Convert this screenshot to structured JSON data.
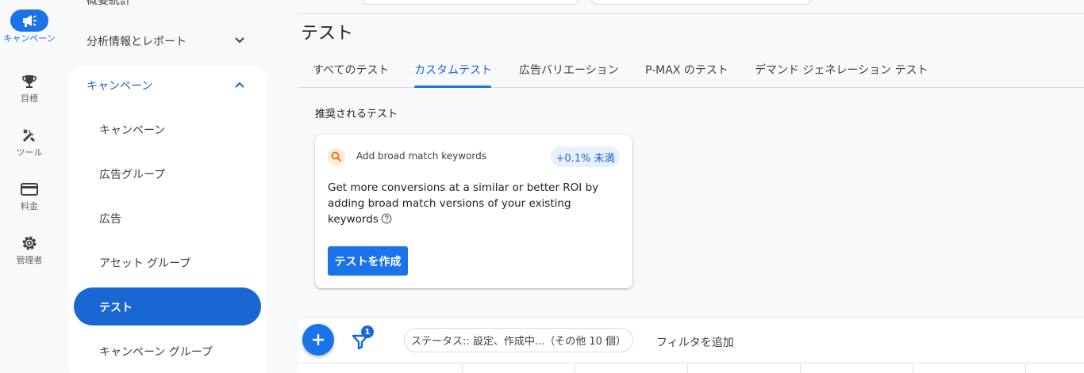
{
  "rail": {
    "items": [
      {
        "label": "キャンペーン",
        "icon": "megaphone-icon",
        "active": true
      },
      {
        "label": "目標",
        "icon": "trophy-icon",
        "active": false
      },
      {
        "label": "ツール",
        "icon": "tools-icon",
        "active": false
      },
      {
        "label": "料金",
        "icon": "credit-card-icon",
        "active": false
      },
      {
        "label": "管理者",
        "icon": "gear-icon",
        "active": false
      }
    ]
  },
  "sidebar": {
    "top_cut_label": "概要統計",
    "analytics_label": "分析情報とレポート",
    "campaign_section_label": "キャンペーン",
    "sub_items": [
      "キャンペーン",
      "広告グループ",
      "広告",
      "アセット グループ",
      "テスト",
      "キャンペーン グループ"
    ],
    "active_item": "テスト"
  },
  "main": {
    "page_title": "テスト",
    "tabs": [
      "すべてのテスト",
      "カスタムテスト",
      "広告バリエーション",
      "P-MAX のテスト",
      "デマンド ジェネレーション テスト"
    ],
    "active_tab": "カスタムテスト",
    "recommended_title": "推奨されるテスト",
    "card": {
      "icon": "search-icon",
      "heading": "Add broad match keywords",
      "badge": "+0.1% 未満",
      "body": "Get more conversions at a similar or better ROI by adding broad match versions of your existing keywords",
      "button_label": "テストを作成"
    },
    "filter_bar": {
      "filter_count": "1",
      "status_chip": "ステータス:: 設定、作成中...（その他 10 個）",
      "add_filter_label": "フィルタを追加"
    }
  },
  "colors": {
    "accent": "#1a73e8",
    "active_bg": "#1967d2"
  }
}
